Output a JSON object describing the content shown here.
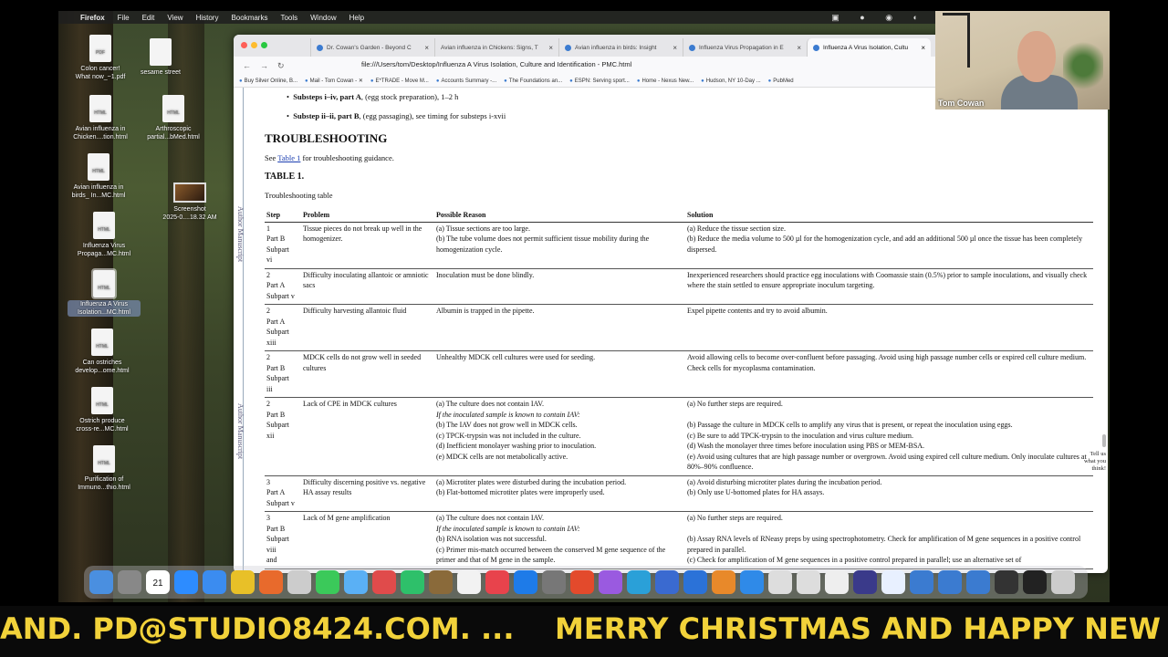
{
  "menubar": {
    "app": "Firefox",
    "items": [
      "File",
      "Edit",
      "View",
      "History",
      "Bookmarks",
      "Tools",
      "Window",
      "Help"
    ]
  },
  "desktop_icons": [
    {
      "label": "Colon cancer!\nWhat now_~1.pdf"
    },
    {
      "label": "sesame street"
    },
    {
      "label": "Avian influenza in\nChicken....tion.html"
    },
    {
      "label": "Arthroscopic\npartial...bMed.html"
    },
    {
      "label": "Avian influenza in\nbirds_ In...MC.html"
    },
    {
      "label": "Screenshot\n2025-0....18.32 AM"
    },
    {
      "label": "Influenza Virus\nPropaga...MC.html"
    },
    {
      "label": "Influenza A Virus\nIsolation...MC.html"
    },
    {
      "label": "Can ostriches\ndevelop...ome.html"
    },
    {
      "label": "Ostrich produce\ncross-re...MC.html"
    },
    {
      "label": "Purification of\nImmuno...thio.html"
    }
  ],
  "browser": {
    "tabs": [
      {
        "title": "Dr. Cowan's Garden - Beyond C"
      },
      {
        "title": "Avian influenza in Chickens: Signs, T"
      },
      {
        "title": "Avian influenza in birds: Insight"
      },
      {
        "title": "Influenza Virus Propagation in E"
      },
      {
        "title": "Influenza A Virus Isolation, Cultu"
      }
    ],
    "url": "file:///Users/tom/Desktop/Influenza A Virus Isolation, Culture and Identification - PMC.html",
    "bookmarks": [
      "Buy Silver Online, B...",
      "Mail - Tom Cowan - ✕",
      "E*TRADE - Move M...",
      "Accounts Summary -...",
      "The Foundations an...",
      "ESPN: Serving sport...",
      "Home - Nexus New...",
      "Hudson, NY 10-Day ...",
      "PubMed"
    ]
  },
  "article": {
    "author_manuscript": "Author Manuscript",
    "substep1_bold": "Substeps i–iv, part A",
    "substep1_rest": ", (egg stock preparation), 1–2 h",
    "substep2_bold": "Substep ii–ii, part B",
    "substep2_rest": ", (egg passaging), see timing for substeps i-xvii",
    "heading": "TROUBLESHOOTING",
    "see_pre": "See ",
    "see_link": "Table 1",
    "see_post": " for troubleshooting guidance.",
    "table_label": "TABLE 1.",
    "table_caption": "Troubleshooting table",
    "headers": [
      "Step",
      "Problem",
      "Possible Reason",
      "Solution"
    ],
    "rows": [
      {
        "step": "1\nPart B\nSubpart\nvi",
        "problem": "Tissue pieces do not break up well in the homogenizer.",
        "reason": "(a) Tissue sections are too large.\n(b) The tube volume does not permit sufficient tissue mobility during the homogenization cycle.",
        "solution": "(a) Reduce the tissue section size.\n(b) Reduce the media volume to 500 µl for the homogenization cycle, and add an additional 500 µl once the tissue has been completely dispersed."
      },
      {
        "step": "2\nPart A\nSubpart v",
        "problem": "Difficulty inoculating allantoic or amniotic sacs",
        "reason": "Inoculation must be done blindly.",
        "solution": "Inexperienced researchers should practice egg inoculations with Coomassie stain (0.5%) prior to sample inoculations, and visually check where the stain settled to ensure appropriate inoculum targeting."
      },
      {
        "step": "2\nPart A\nSubpart\nxiii",
        "problem": "Difficulty harvesting allantoic fluid",
        "reason": "Albumin is trapped in the pipette.",
        "solution": "Expel pipette contents and try to avoid albumin."
      },
      {
        "step": "2\nPart B\nSubpart\niii",
        "problem": "MDCK cells do not grow well in seeded cultures",
        "reason": "Unhealthy MDCK cell cultures were used for seeding.",
        "solution": "Avoid allowing cells to become over-confluent before passaging. Avoid using high passage number cells or expired cell culture medium. Check cells for mycoplasma contamination."
      },
      {
        "step": "2\nPart B\nSubpart\nxii",
        "problem": "Lack of CPE in MDCK cultures",
        "reason": "(a) The culture does not contain IAV.\n*If the inoculated sample is known to contain IAV:*\n(b) The IAV does not grow well in MDCK cells.\n(c) TPCK-trypsin was not included in the culture.\n(d) Inefficient monolayer washing prior to inoculation.\n(e) MDCK cells are not metabolically active.",
        "solution": "(a) No further steps are required.\n\n(b) Passage the culture in MDCK cells to amplify any virus that is present, or repeat the inoculation using eggs.\n(c) Be sure to add TPCK-trypsin to the inoculation and virus culture medium.\n(d) Wash the monolayer three times before inoculation using PBS or MEM-BSA.\n(e) Avoid using cultures that are high passage number or overgrown. Avoid using expired cell culture medium. Only inoculate cultures at 80%–90% confluence."
      },
      {
        "step": "3\nPart A\nSubpart v",
        "problem": "Difficulty discerning positive vs. negative HA assay results",
        "reason": "(a) Microtiter plates were disturbed during the incubation period.\n(b) Flat-bottomed microtiter plates were improperly used.",
        "solution": "(a) Avoid disturbing microtiter plates during the incubation period.\n(b) Only use U-bottomed plates for HA assays."
      },
      {
        "step": "3\nPart B\nSubpart\nviii\nand",
        "problem": "Lack of M gene amplification",
        "reason": "(a) The culture does not contain IAV.\n*If the inoculated sample is known to contain IAV:*\n(b) RNA isolation was not successful.\n(c) Primer mis-match occurred between the conserved M gene sequence of the primer and that of M gene in the sample.",
        "solution": "(a) No further steps are required.\n\n(b) Assay RNA levels of RNeasy preps by using spectrophotometry. Check for amplification of M gene sequences in a positive control prepared in parallel.\n(c) Check for amplification of M gene sequences in a positive control prepared in parallel; use an alternative set of"
      }
    ],
    "feedback": "Tell us what you think!"
  },
  "webcam": {
    "name": "Tom Cowan"
  },
  "ticker": {
    "text": "AND. PD@STUDIO8424.COM. ...    MERRY CHRISTMAS AND HAPPY NEW Y"
  },
  "dock": {
    "calendar_day": "21"
  }
}
